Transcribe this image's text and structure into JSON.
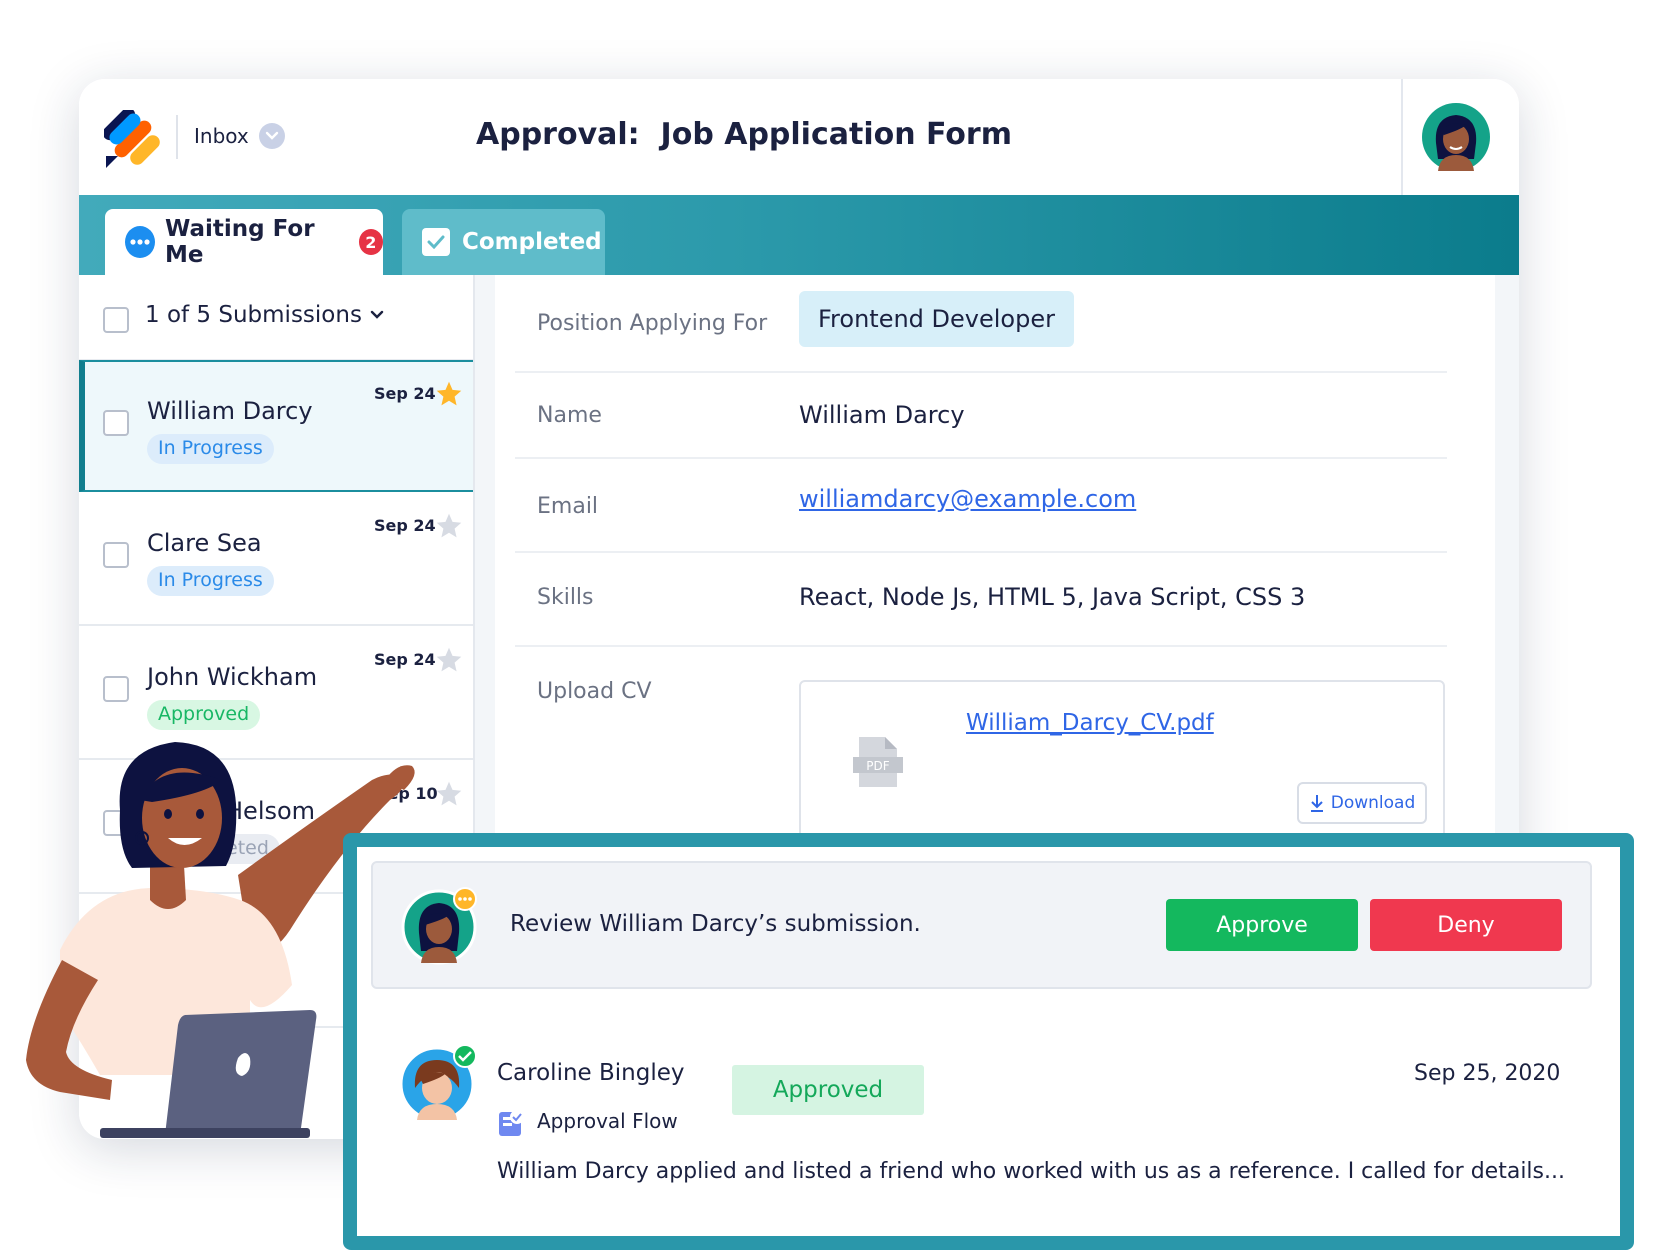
{
  "header": {
    "inbox_label": "Inbox",
    "title": "Approval:  Job Application Form"
  },
  "tabs": [
    {
      "label": "Waiting For Me",
      "badge": "2"
    },
    {
      "label": "Completed"
    }
  ],
  "list": {
    "count_label": "1 of 5 Submissions",
    "items": [
      {
        "name": "William Darcy",
        "date": "Sep 24",
        "status": "In Progress",
        "starred": true
      },
      {
        "name": "Clare Sea",
        "date": "Sep 24",
        "status": "In Progress",
        "starred": false
      },
      {
        "name": "John Wickham",
        "date": "Sep 24",
        "status": "Approved",
        "starred": false
      },
      {
        "name": "Helsom",
        "date": "Sep 10",
        "status": "eted",
        "starred": false
      }
    ]
  },
  "detail": {
    "position_label": "Position Applying For",
    "position_value": "Frontend Developer",
    "name_label": "Name",
    "name_value": "William Darcy",
    "email_label": "Email",
    "email_value": "williamdarcy@example.com",
    "skills_label": "Skills",
    "skills_value": "React, Node Js, HTML 5, Java Script, CSS 3",
    "cv_label": "Upload CV",
    "cv_file": "William_Darcy_CV.pdf",
    "pdf_icon_text": "PDF",
    "download_label": "Download"
  },
  "approval": {
    "review_text": "Review William Darcy’s submission.",
    "approve_label": "Approve",
    "deny_label": "Deny",
    "reviewer_name": "Caroline Bingley",
    "flow_label": "Approval Flow",
    "reviewer_status": "Approved",
    "date": "Sep 25, 2020",
    "comment": "William Darcy applied and listed a friend who worked with us as a reference. I called for details..."
  },
  "colors": {
    "accent": "#1b8e9e",
    "approve": "#14b85e",
    "deny": "#f0384f",
    "link": "#2f66e6"
  }
}
